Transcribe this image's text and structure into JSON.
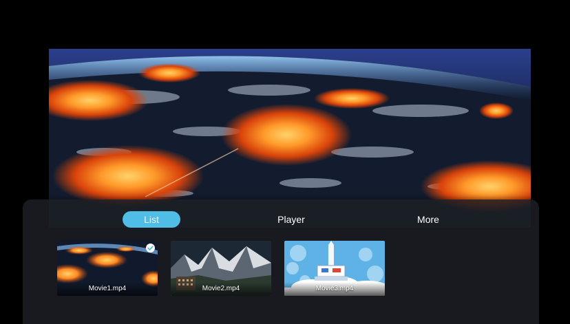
{
  "tabs": [
    {
      "label": "List",
      "active": true
    },
    {
      "label": "Player",
      "active": false
    },
    {
      "label": "More",
      "active": false
    }
  ],
  "videos": [
    {
      "filename": "Movie1.mp4",
      "selected": true
    },
    {
      "filename": "Movie2.mp4",
      "selected": false
    },
    {
      "filename": "Movie3.mp4",
      "selected": false
    }
  ],
  "colors": {
    "accent": "#4fbde5",
    "panel": "#1c1e24",
    "background": "#000000"
  },
  "icons": {
    "selected": "check-icon"
  }
}
